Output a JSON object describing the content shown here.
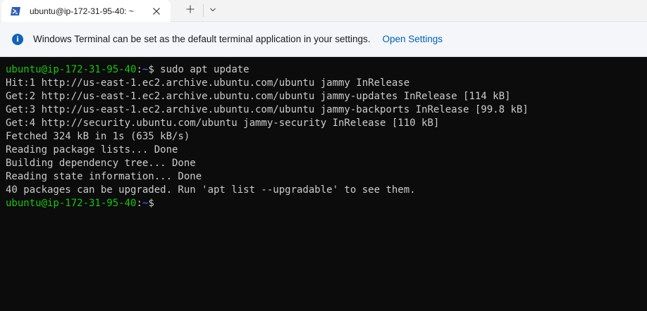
{
  "tab": {
    "title": "ubuntu@ip-172-31-95-40: ~"
  },
  "infobar": {
    "message": "Windows Terminal can be set as the default terminal application in your settings.",
    "link_label": "Open Settings"
  },
  "colors": {
    "prompt_user": "#16c60c",
    "prompt_path": "#3b78ff",
    "terminal_bg": "#0c0c0c",
    "terminal_fg": "#cccccc",
    "link": "#005fb8"
  },
  "terminal": {
    "prompt_user_host": "ubuntu@ip-172-31-95-40",
    "prompt_colon": ":",
    "prompt_path": "~",
    "prompt_symbol": "$",
    "command": " sudo apt update",
    "output": [
      "Hit:1 http://us-east-1.ec2.archive.ubuntu.com/ubuntu jammy InRelease",
      "Get:2 http://us-east-1.ec2.archive.ubuntu.com/ubuntu jammy-updates InRelease [114 kB]",
      "Get:3 http://us-east-1.ec2.archive.ubuntu.com/ubuntu jammy-backports InRelease [99.8 kB]",
      "Get:4 http://security.ubuntu.com/ubuntu jammy-security InRelease [110 kB]",
      "Fetched 324 kB in 1s (635 kB/s)",
      "Reading package lists... Done",
      "Building dependency tree... Done",
      "Reading state information... Done",
      "40 packages can be upgraded. Run 'apt list --upgradable' to see them."
    ]
  }
}
